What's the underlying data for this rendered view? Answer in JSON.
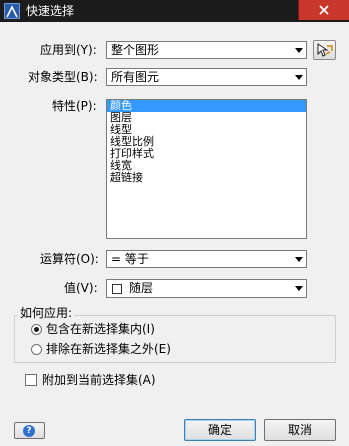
{
  "window": {
    "title": "快速选择"
  },
  "form": {
    "apply_to": {
      "label": "应用到(Y):",
      "value": "整个图形"
    },
    "object_type": {
      "label": "对象类型(B):",
      "value": "所有图元"
    },
    "properties": {
      "label": "特性(P):",
      "items": [
        "颜色",
        "图层",
        "线型",
        "线型比例",
        "打印样式",
        "线宽",
        "超链接"
      ],
      "selected_index": 0
    },
    "operator": {
      "label": "运算符(O):",
      "value": "= 等于"
    },
    "value": {
      "label": "值(V):",
      "value": "随层"
    }
  },
  "how_to_apply": {
    "label": "如何应用:",
    "options": [
      {
        "label": "包含在新选择集内(I)",
        "checked": true
      },
      {
        "label": "排除在新选择集之外(E)",
        "checked": false
      }
    ]
  },
  "append_checkbox": {
    "label": "附加到当前选择集(A)",
    "checked": false
  },
  "buttons": {
    "ok": "确定",
    "cancel": "取消",
    "help": "?"
  },
  "colors": {
    "selection": "#3399ff",
    "titlebar": "#1c1c1c",
    "close": "#c7372b"
  },
  "icons": [
    "app-icon",
    "close-icon",
    "select-objects-icon",
    "help-icon",
    "dropdown-arrow-icon"
  ]
}
